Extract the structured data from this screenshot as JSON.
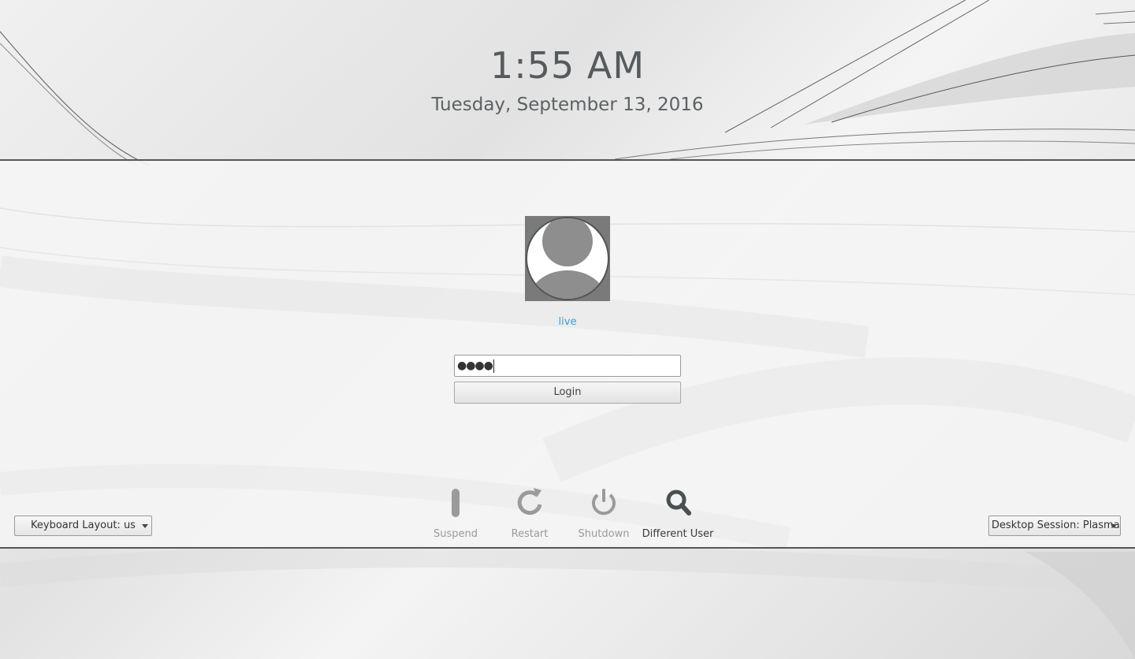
{
  "clock": {
    "time": "1:55 AM",
    "date": "Tuesday, September 13, 2016"
  },
  "user": {
    "name": "live",
    "avatar_icon": "user-avatar-icon"
  },
  "password": {
    "masked_value": "●●●●"
  },
  "login": {
    "label": "Login"
  },
  "keyboard_layout": {
    "label": "Keyboard Layout: us"
  },
  "desktop_session": {
    "label": "Desktop Session: Plasma"
  },
  "actions": [
    {
      "label": "Suspend",
      "icon": "suspend-icon"
    },
    {
      "label": "Restart",
      "icon": "restart-icon"
    },
    {
      "label": "Shutdown",
      "icon": "shutdown-icon"
    },
    {
      "label": "Different User",
      "icon": "search-icon"
    }
  ],
  "colors": {
    "username": "#3a9fd6",
    "text": "#555a5c",
    "border": "#555555"
  }
}
